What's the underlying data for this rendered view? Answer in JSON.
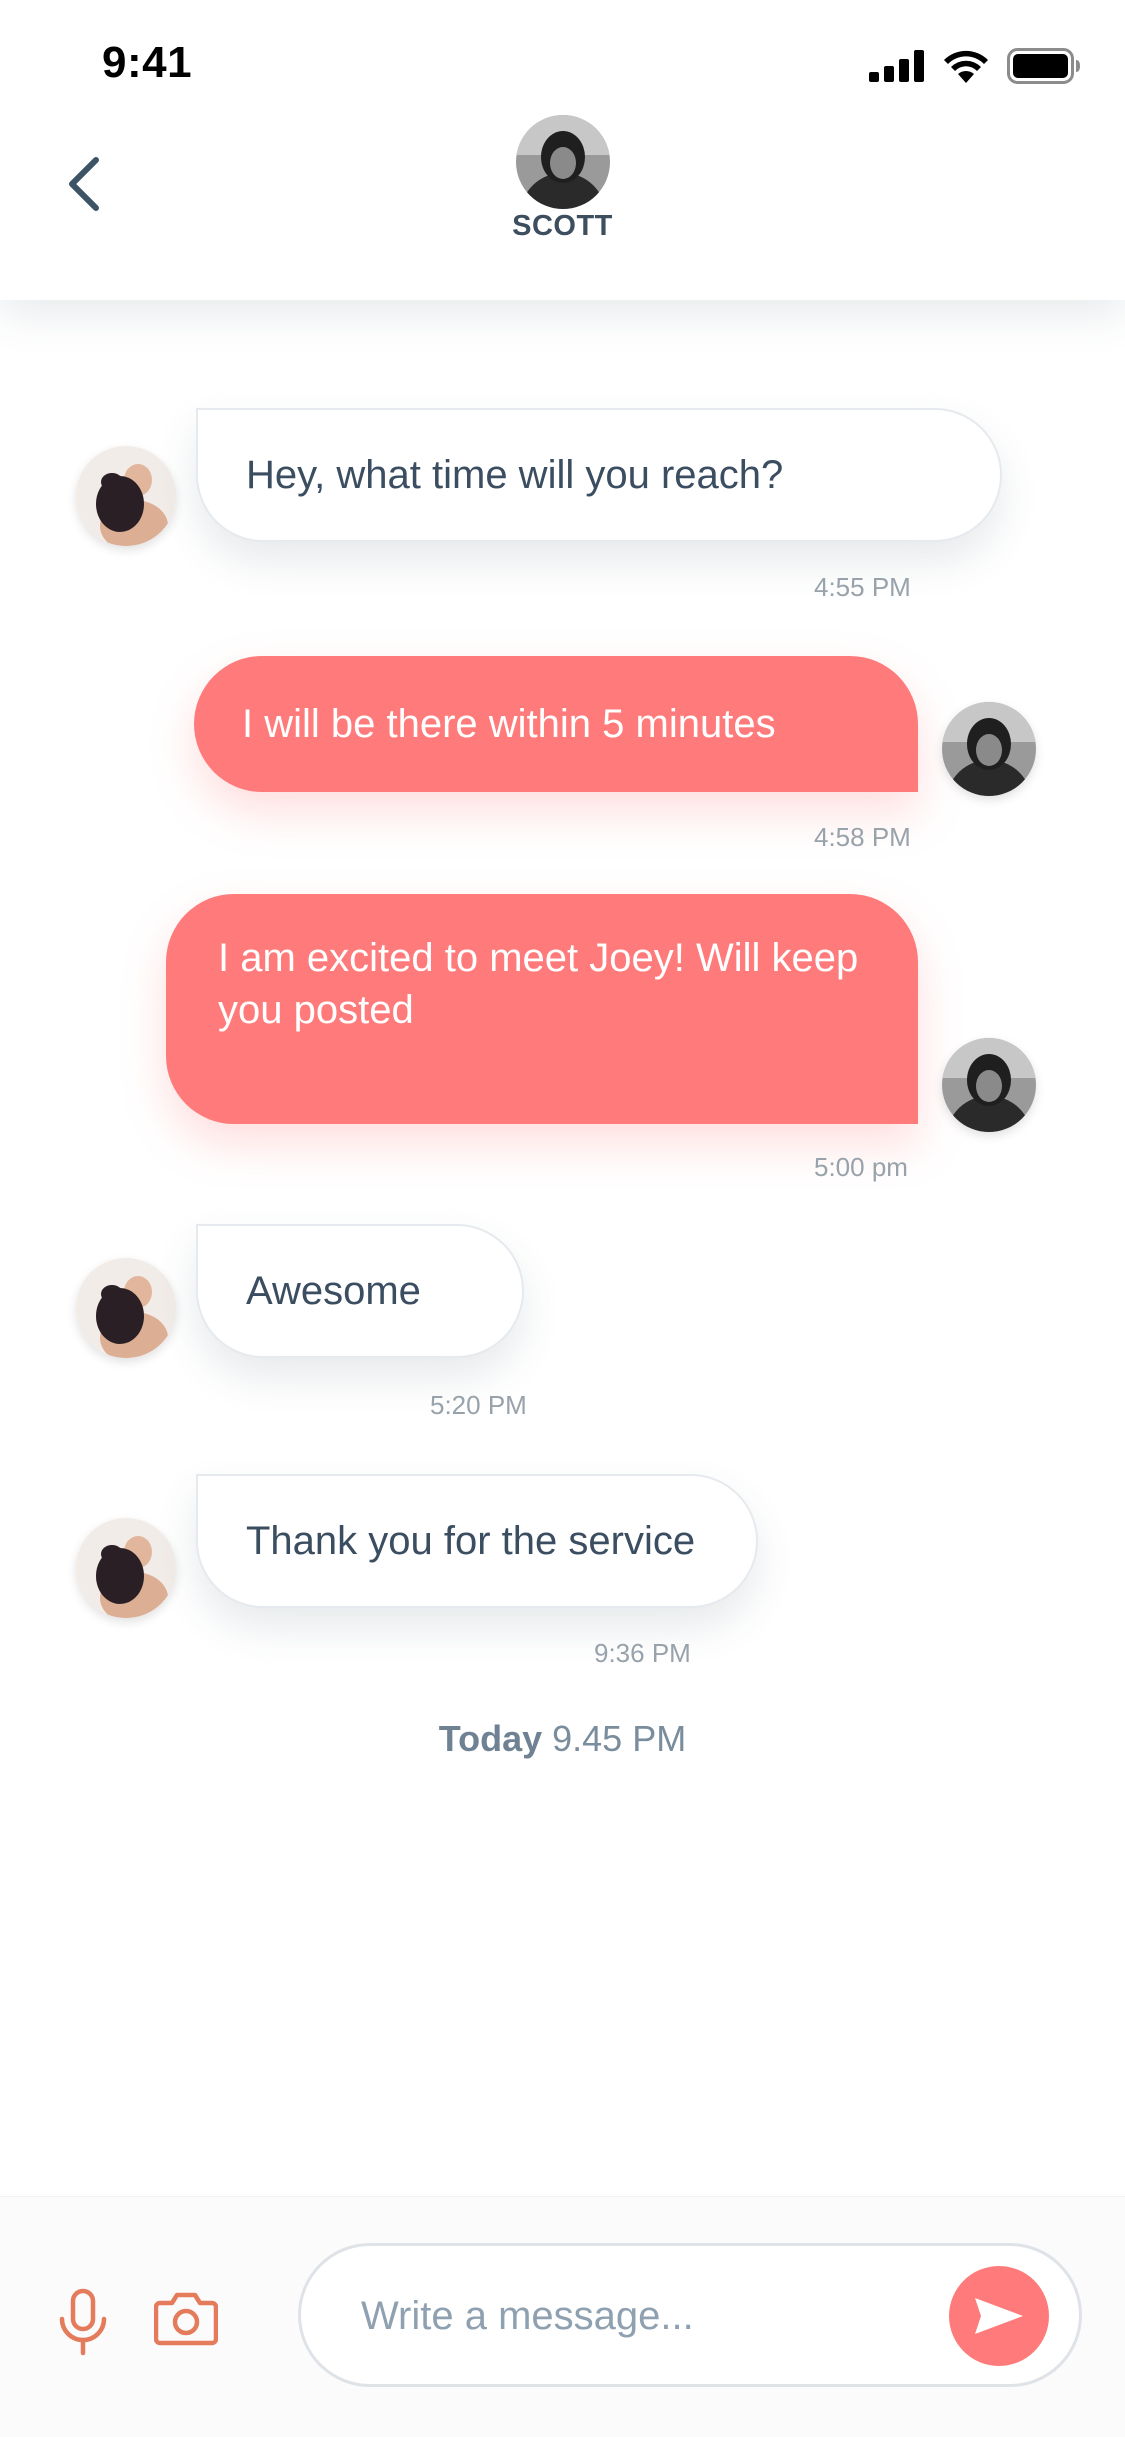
{
  "status_bar": {
    "time": "9:41",
    "icons": [
      "cellular-signal-icon",
      "wifi-icon",
      "battery-icon"
    ]
  },
  "header": {
    "back_icon": "chevron-left-icon",
    "contact_name": "SCOTT"
  },
  "messages": [
    {
      "direction": "incoming",
      "text": "Hey, what time will you reach?",
      "time": "4:55 PM"
    },
    {
      "direction": "outgoing",
      "text": "I will be there within 5 minutes",
      "time": "4:58 PM"
    },
    {
      "direction": "outgoing",
      "text": "I am excited to meet Joey! Will keep you posted",
      "time": "5:00 pm"
    },
    {
      "direction": "incoming",
      "text": "Awesome",
      "time": "5:20 PM"
    },
    {
      "direction": "incoming",
      "text": "Thank you for the service",
      "time": "9:36 PM"
    }
  ],
  "day_separator": {
    "label": "Today",
    "time": "9.45 PM"
  },
  "composer": {
    "placeholder": "Write a message...",
    "icons": [
      "microphone-icon",
      "camera-icon",
      "send-icon"
    ]
  },
  "colors": {
    "outgoing_bubble": "#ff7b7b",
    "incoming_bubble": "#ffffff",
    "text_dark": "#3b4d60",
    "timestamp": "#98a2ab",
    "mic_camera_accent": "#e47c5c"
  }
}
